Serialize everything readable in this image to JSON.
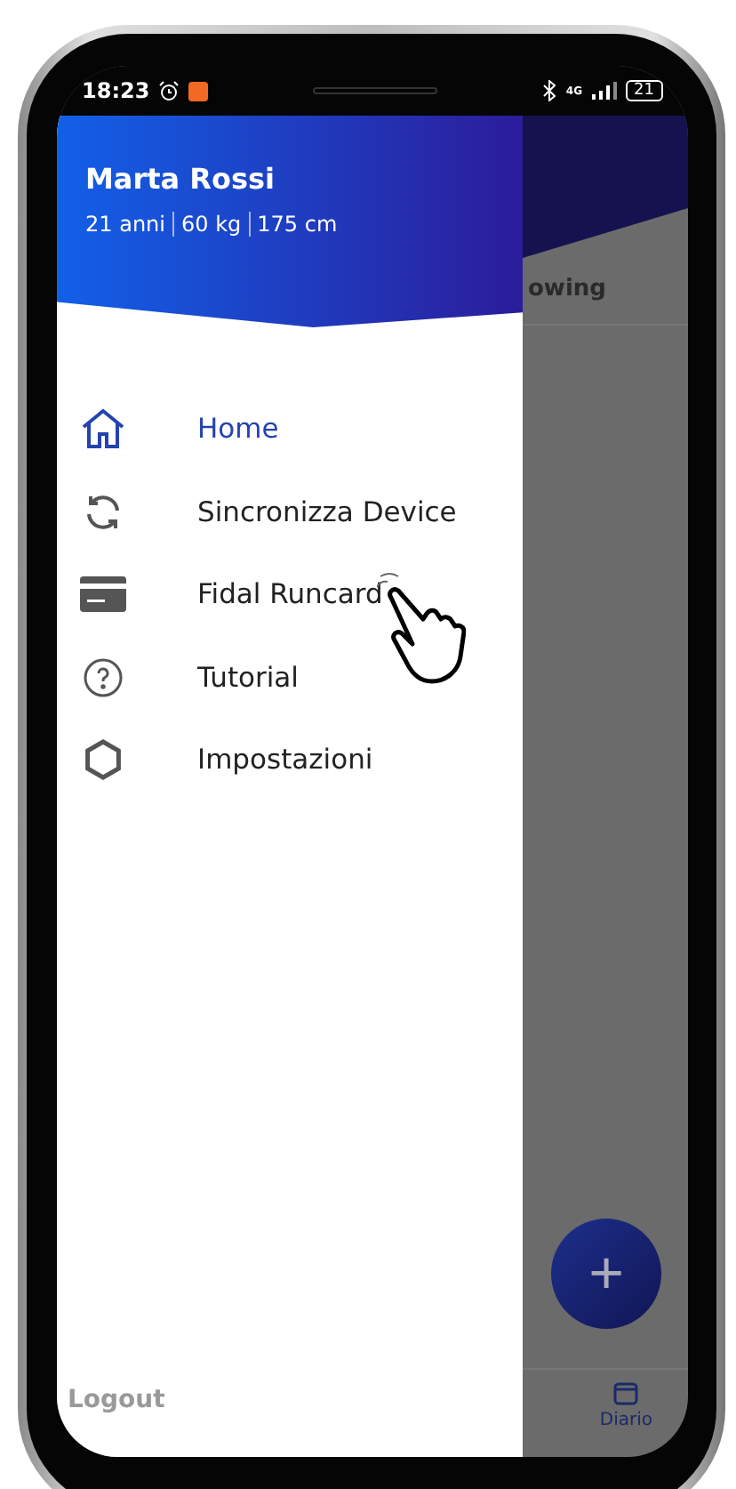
{
  "status_bar": {
    "time": "18:23",
    "network": "4G",
    "battery": "21"
  },
  "drawer": {
    "user": {
      "name": "Marta Rossi",
      "stats": [
        "21 anni",
        "60 kg",
        "175 cm"
      ]
    },
    "items": [
      {
        "label": "Home",
        "selected": true
      },
      {
        "label": "Sincronizza Device",
        "selected": false
      },
      {
        "label": "Fidal Runcard",
        "selected": false
      },
      {
        "label": "Tutorial",
        "selected": false
      },
      {
        "label": "Impostazioni",
        "selected": false
      }
    ],
    "logout": "Logout"
  },
  "background": {
    "tab_label": "owing",
    "fab": "+",
    "bottom_nav": [
      {
        "label": "Diario",
        "selected": true
      }
    ]
  }
}
